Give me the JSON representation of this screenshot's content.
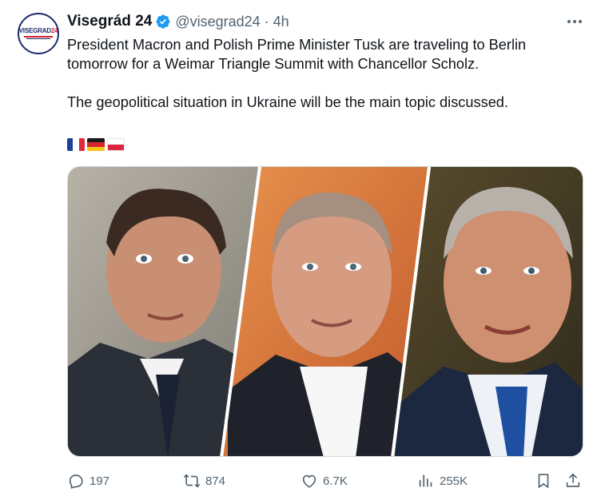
{
  "tweet": {
    "avatar_alt": "Visegrád 24 logo",
    "avatar_logo_text": "VISEGRAD24",
    "display_name": "Visegrád 24",
    "handle": "@visegrad24",
    "separator": "·",
    "time": "4h",
    "text_line1": "President Macron and Polish Prime Minister Tusk are traveling to Berlin",
    "text_line2": "tomorrow for a Weimar Triangle Summit with Chancellor Scholz.",
    "text_para2": "The geopolitical situation in Ukraine will be the main topic discussed.",
    "flags": [
      "france-flag",
      "germany-flag",
      "poland-flag"
    ]
  },
  "actions": {
    "replies": "197",
    "reposts": "874",
    "likes": "6.7K",
    "views": "255K"
  },
  "colors": {
    "text_primary": "#0f1419",
    "text_secondary": "#536471",
    "verified_blue": "#1d9bf0",
    "border": "#cfd9de"
  }
}
